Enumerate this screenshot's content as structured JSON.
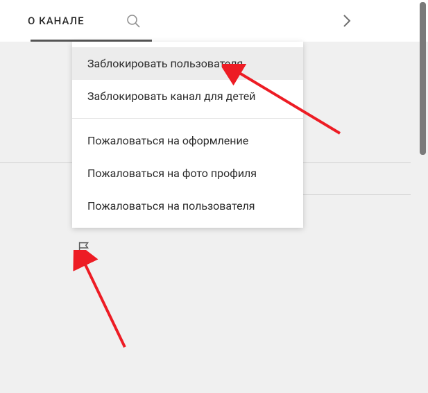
{
  "tabs": {
    "active_label": "О КАНАЛЕ"
  },
  "menu": {
    "group1": [
      {
        "label": "Заблокировать пользователя"
      },
      {
        "label": "Заблокировать канал для детей"
      }
    ],
    "group2": [
      {
        "label": "Пожаловаться на оформление"
      },
      {
        "label": "Пожаловаться на фото профиля"
      },
      {
        "label": "Пожаловаться на пользователя"
      }
    ]
  },
  "colors": {
    "annotation_arrow": "#ed1c24"
  }
}
